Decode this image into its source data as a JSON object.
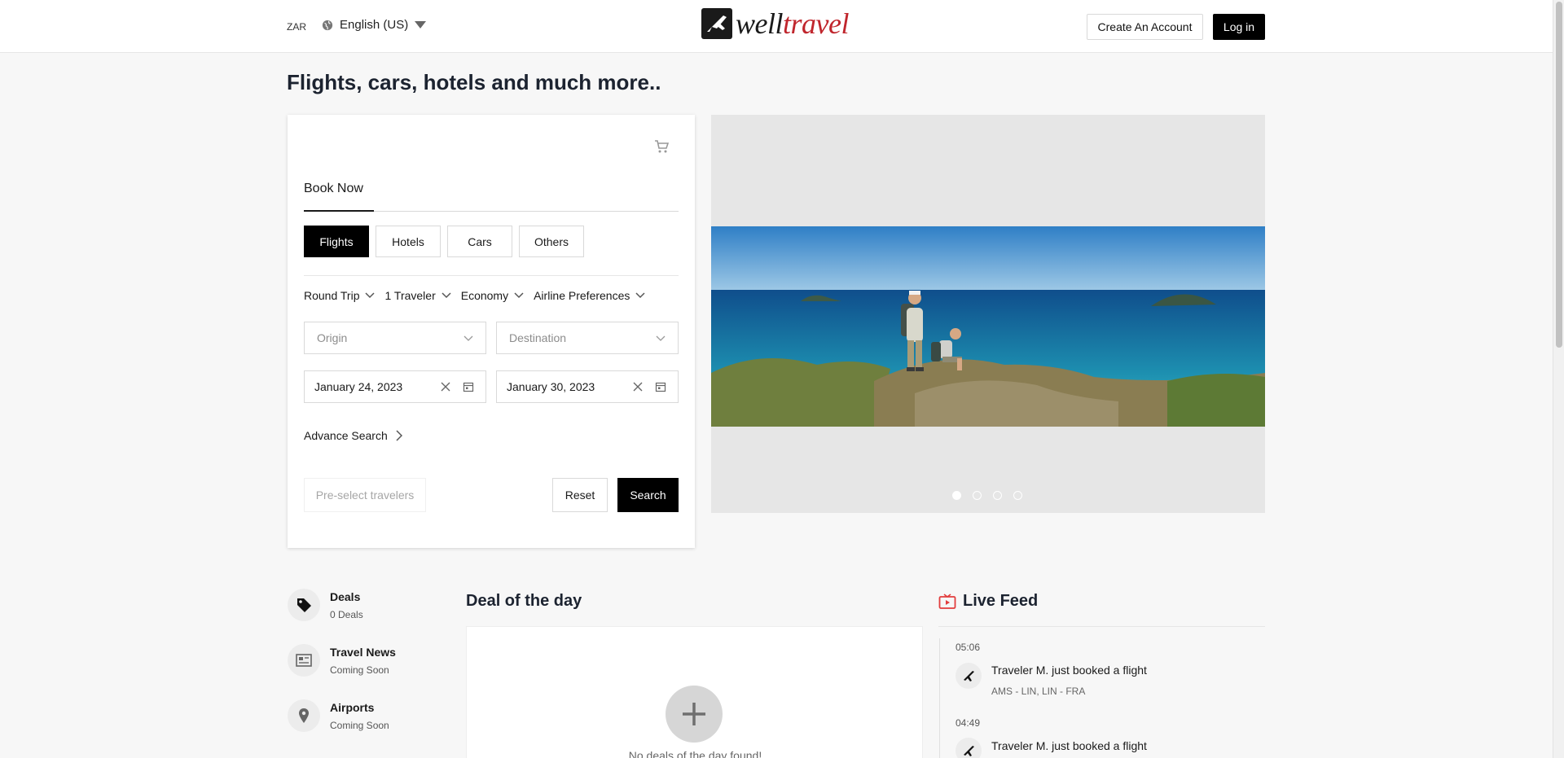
{
  "header": {
    "currency": "ZAR",
    "language": "English (US)",
    "logo": {
      "part1": "well",
      "part2": "travel"
    },
    "create_account": "Create An Account",
    "login": "Log in"
  },
  "page_title": "Flights, cars, hotels and much more..",
  "booking": {
    "tab": "Book Now",
    "types": [
      "Flights",
      "Hotels",
      "Cars",
      "Others"
    ],
    "active_type": "Flights",
    "trip_type": "Round Trip",
    "travelers": "1 Traveler",
    "cabin": "Economy",
    "airline_pref": "Airline Preferences",
    "origin_placeholder": "Origin",
    "destination_placeholder": "Destination",
    "depart_date": "January 24, 2023",
    "return_date": "January 30, 2023",
    "advance_search": "Advance Search",
    "preselect": "Pre-select travelers",
    "reset": "Reset",
    "search": "Search"
  },
  "carousel": {
    "slides": 4,
    "active": 1
  },
  "sidebar": [
    {
      "title": "Deals",
      "subtitle": "0 Deals",
      "icon": "tag-icon"
    },
    {
      "title": "Travel News",
      "subtitle": "Coming Soon",
      "icon": "newspaper-icon"
    },
    {
      "title": "Airports",
      "subtitle": "Coming Soon",
      "icon": "location-pin-icon"
    }
  ],
  "deal_of_day": {
    "title": "Deal of the day",
    "empty": "No deals of the day found!"
  },
  "live_feed": {
    "title": "Live Feed",
    "items": [
      {
        "time": "05:06",
        "text": "Traveler M. just booked a flight",
        "route": "AMS - LIN, LIN - FRA"
      },
      {
        "time": "04:49",
        "text": "Traveler M. just booked a flight",
        "route": ""
      }
    ]
  },
  "colors": {
    "brand_red": "#c0262d",
    "primary_button": "#000000",
    "accent_live": "#e23d3d"
  }
}
